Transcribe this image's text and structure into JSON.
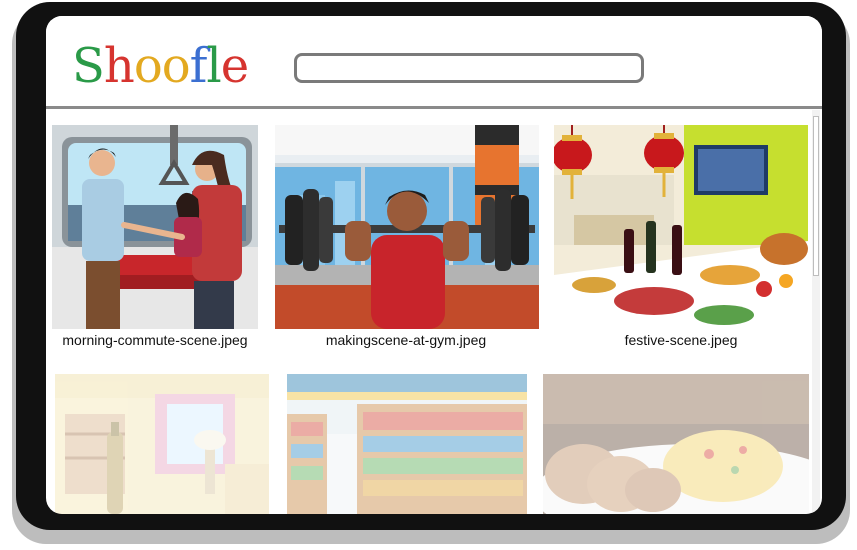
{
  "app": {
    "logo_text": [
      "S",
      "h",
      "o",
      "o",
      "f",
      "l",
      "e"
    ]
  },
  "search": {
    "value": "",
    "placeholder": ""
  },
  "results": [
    {
      "caption": "morning-commute-scene.jpeg",
      "scene": "people arguing in a subway car"
    },
    {
      "caption": "makingscene-at-gym.jpeg",
      "scene": "man lifting a barbell at a gym"
    },
    {
      "caption": "festive-scene.jpeg",
      "scene": "festive table with lanterns and food"
    },
    {
      "caption": "",
      "scene": "faded living room with bottle"
    },
    {
      "caption": "",
      "scene": "faded supermarket aisle"
    },
    {
      "caption": "",
      "scene": "faded plate of rice and bread"
    }
  ],
  "colors": {
    "device_frame": "#111111",
    "logo_green": "#2a9a48",
    "logo_red": "#d6342f",
    "logo_yellow": "#e3a920",
    "logo_blue": "#3b6fd1"
  }
}
